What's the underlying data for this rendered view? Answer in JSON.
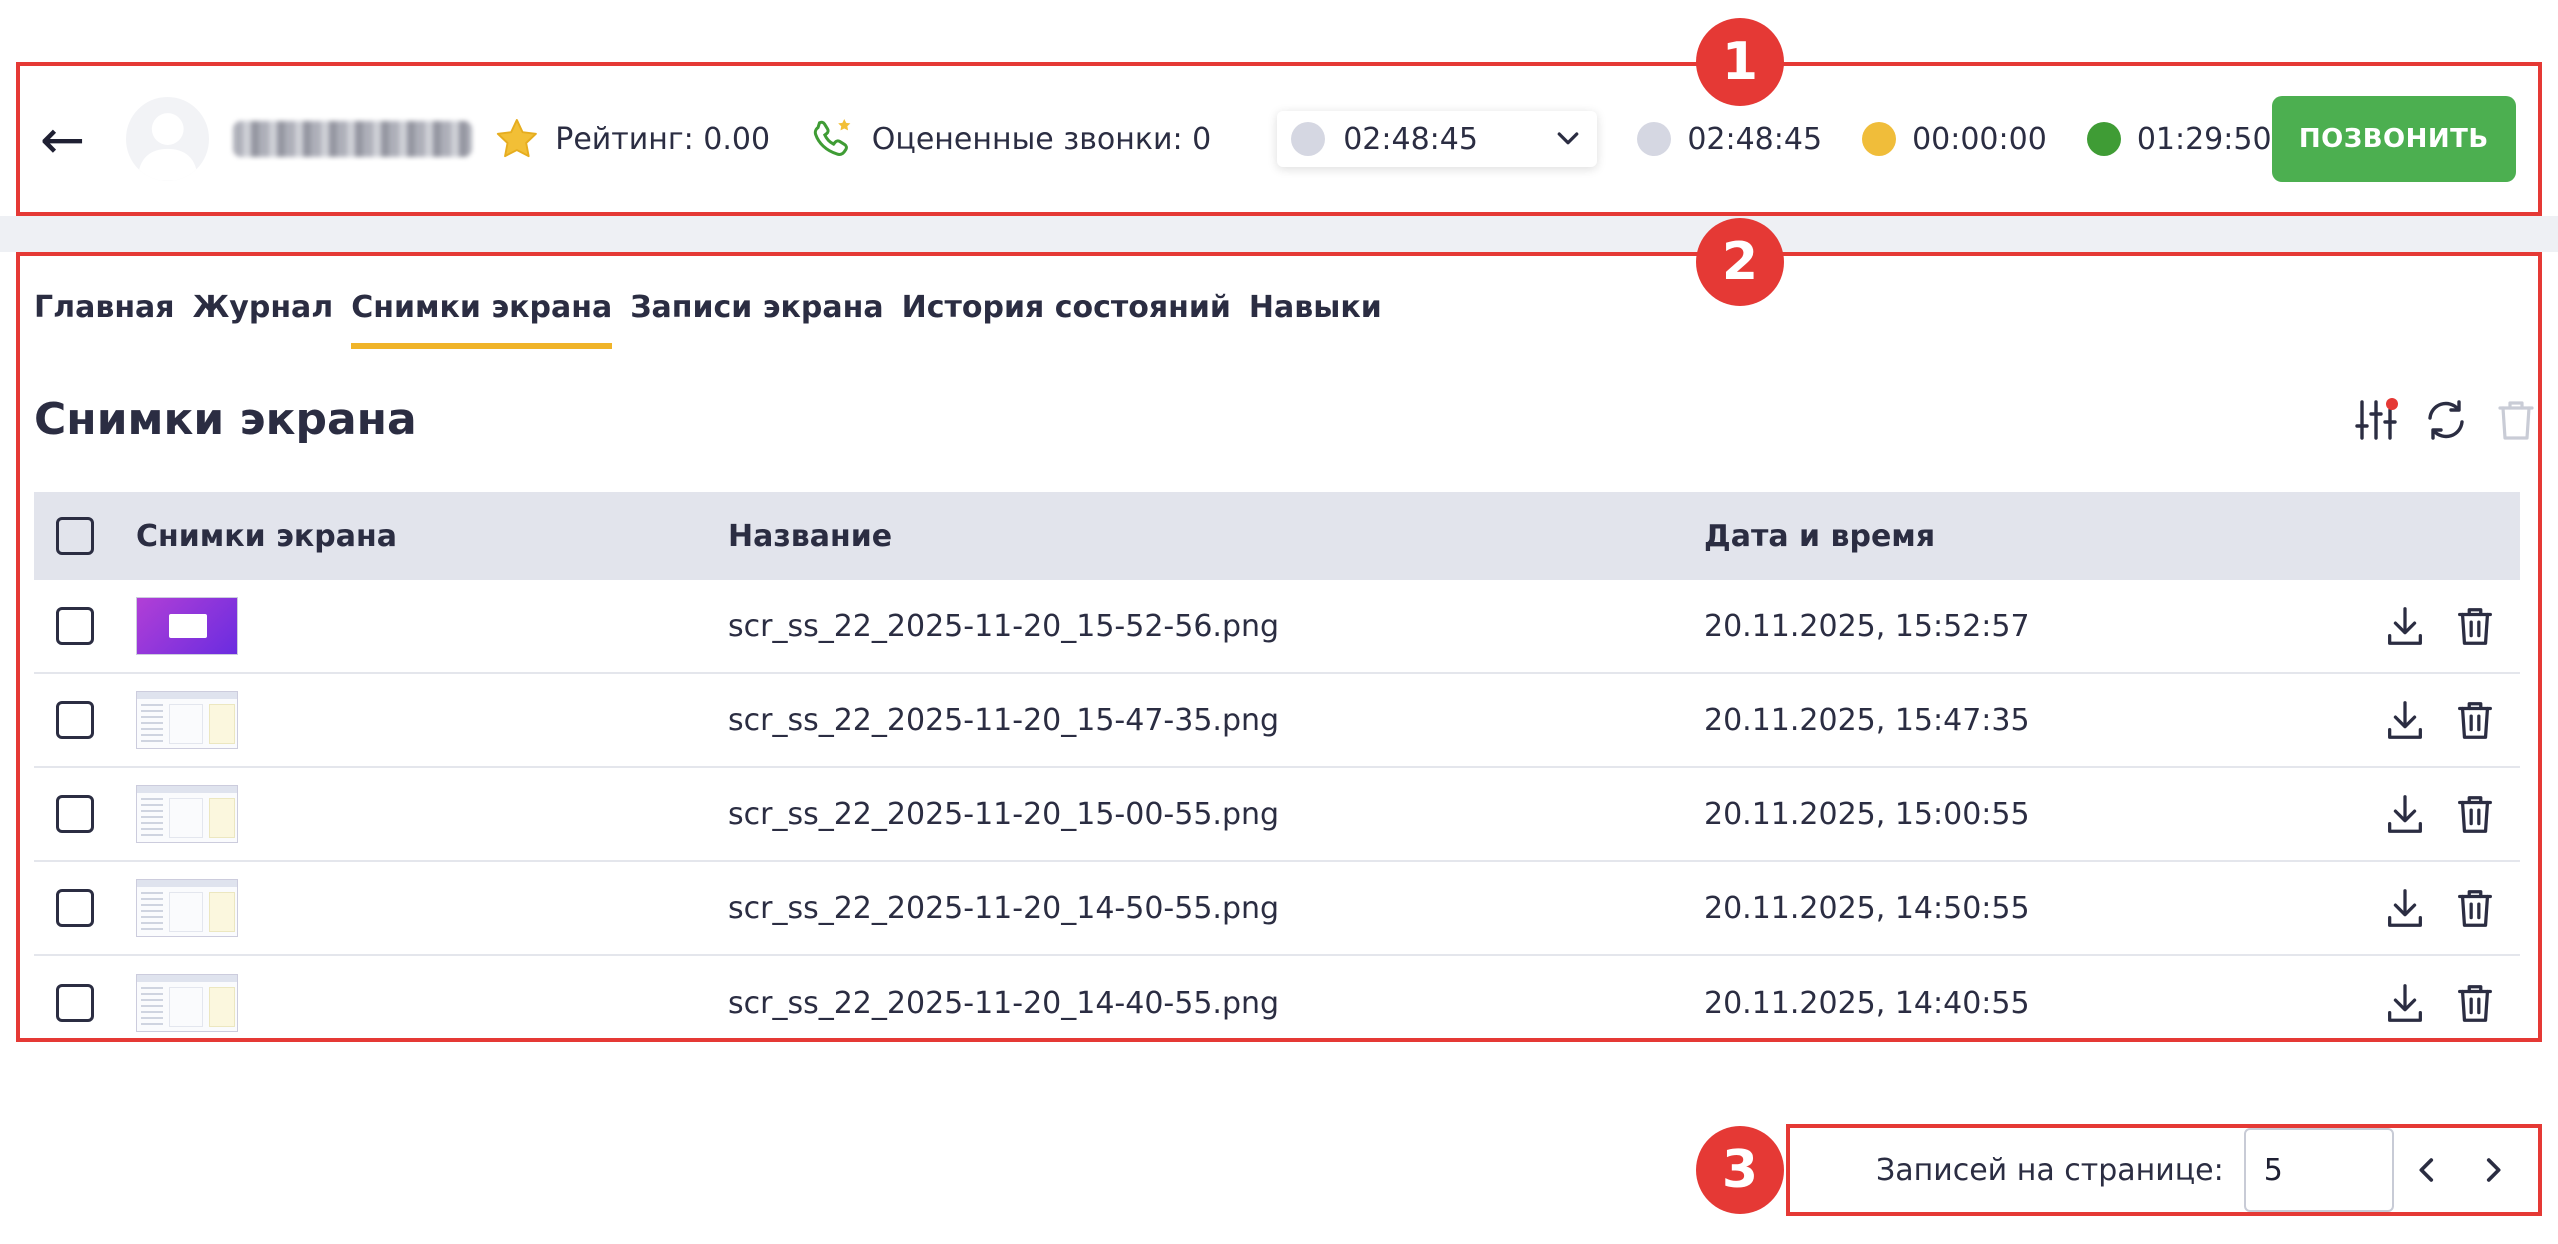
{
  "header": {
    "back_glyph": "←",
    "rating_text": "Рейтинг: 0.00",
    "rated_calls_text": "Оцененные звонки: 0",
    "status_select": {
      "time": "02:48:45",
      "dot_color": "#d5d7e2"
    },
    "statuses": [
      {
        "time": "02:48:45",
        "dot_color": "#d5d7e2"
      },
      {
        "time": "00:00:00",
        "dot_color": "#f0bd3a"
      },
      {
        "time": "01:29:50",
        "dot_color": "#3f9c35"
      }
    ],
    "call_button": "ПОЗВОНИТЬ",
    "call_button_color": "#4caf50"
  },
  "callouts": [
    "1",
    "2",
    "3"
  ],
  "tabs": [
    {
      "label": "Главная",
      "active": false
    },
    {
      "label": "Журнал",
      "active": false
    },
    {
      "label": "Снимки экрана",
      "active": true
    },
    {
      "label": "Записи экрана",
      "active": false
    },
    {
      "label": "История состояний",
      "active": false
    },
    {
      "label": "Навыки",
      "active": false
    }
  ],
  "section_title": "Снимки экрана",
  "table": {
    "headers": {
      "thumb": "Снимки экрана",
      "name": "Название",
      "date": "Дата и время"
    },
    "rows": [
      {
        "name": "scr_ss_22_2025-11-20_15-52-56.png",
        "date": "20.11.2025, 15:52:57",
        "thumb": "purple"
      },
      {
        "name": "scr_ss_22_2025-11-20_15-47-35.png",
        "date": "20.11.2025, 15:47:35",
        "thumb": "shot"
      },
      {
        "name": "scr_ss_22_2025-11-20_15-00-55.png",
        "date": "20.11.2025, 15:00:55",
        "thumb": "shot"
      },
      {
        "name": "scr_ss_22_2025-11-20_14-50-55.png",
        "date": "20.11.2025, 14:50:55",
        "thumb": "shot"
      },
      {
        "name": "scr_ss_22_2025-11-20_14-40-55.png",
        "date": "20.11.2025, 14:40:55",
        "thumb": "shot"
      }
    ]
  },
  "pagination": {
    "label": "Записей на странице:",
    "page_size": "5"
  },
  "colors": {
    "accent": "#f0b429",
    "callout": "#e53935"
  }
}
